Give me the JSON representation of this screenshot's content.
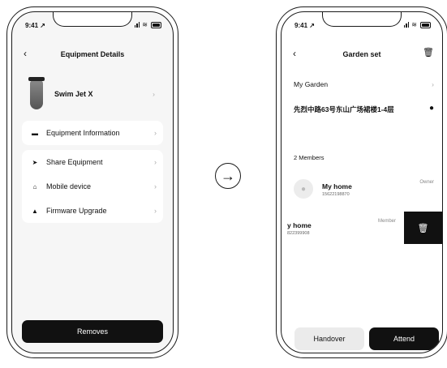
{
  "left_screen": {
    "status": {
      "time": "9:41 ↗"
    },
    "title": "Equipment Details",
    "device_name": "Swim Jet X",
    "menu_group_1": [
      {
        "label": "Equipment Information",
        "icon": "card-icon"
      }
    ],
    "menu_group_2": [
      {
        "label": "Share Equipment",
        "icon": "send-icon"
      },
      {
        "label": "Mobile device",
        "icon": "home-icon"
      },
      {
        "label": "Firmware Upgrade",
        "icon": "upload-icon"
      }
    ],
    "remove_label": "Removes"
  },
  "right_screen": {
    "status": {
      "time": "9:41 ↗"
    },
    "title": "Garden set",
    "garden_name": "My Garden",
    "address": "先烈中路63号东山广场裙楼1-4层",
    "members_count": "2 Members",
    "members": [
      {
        "name": "My home",
        "phone": "15622198870",
        "role": "Owner"
      },
      {
        "name": "y home",
        "phone": "822399908",
        "role": "Member"
      }
    ],
    "handover_label": "Handover",
    "attend_label": "Attend"
  }
}
